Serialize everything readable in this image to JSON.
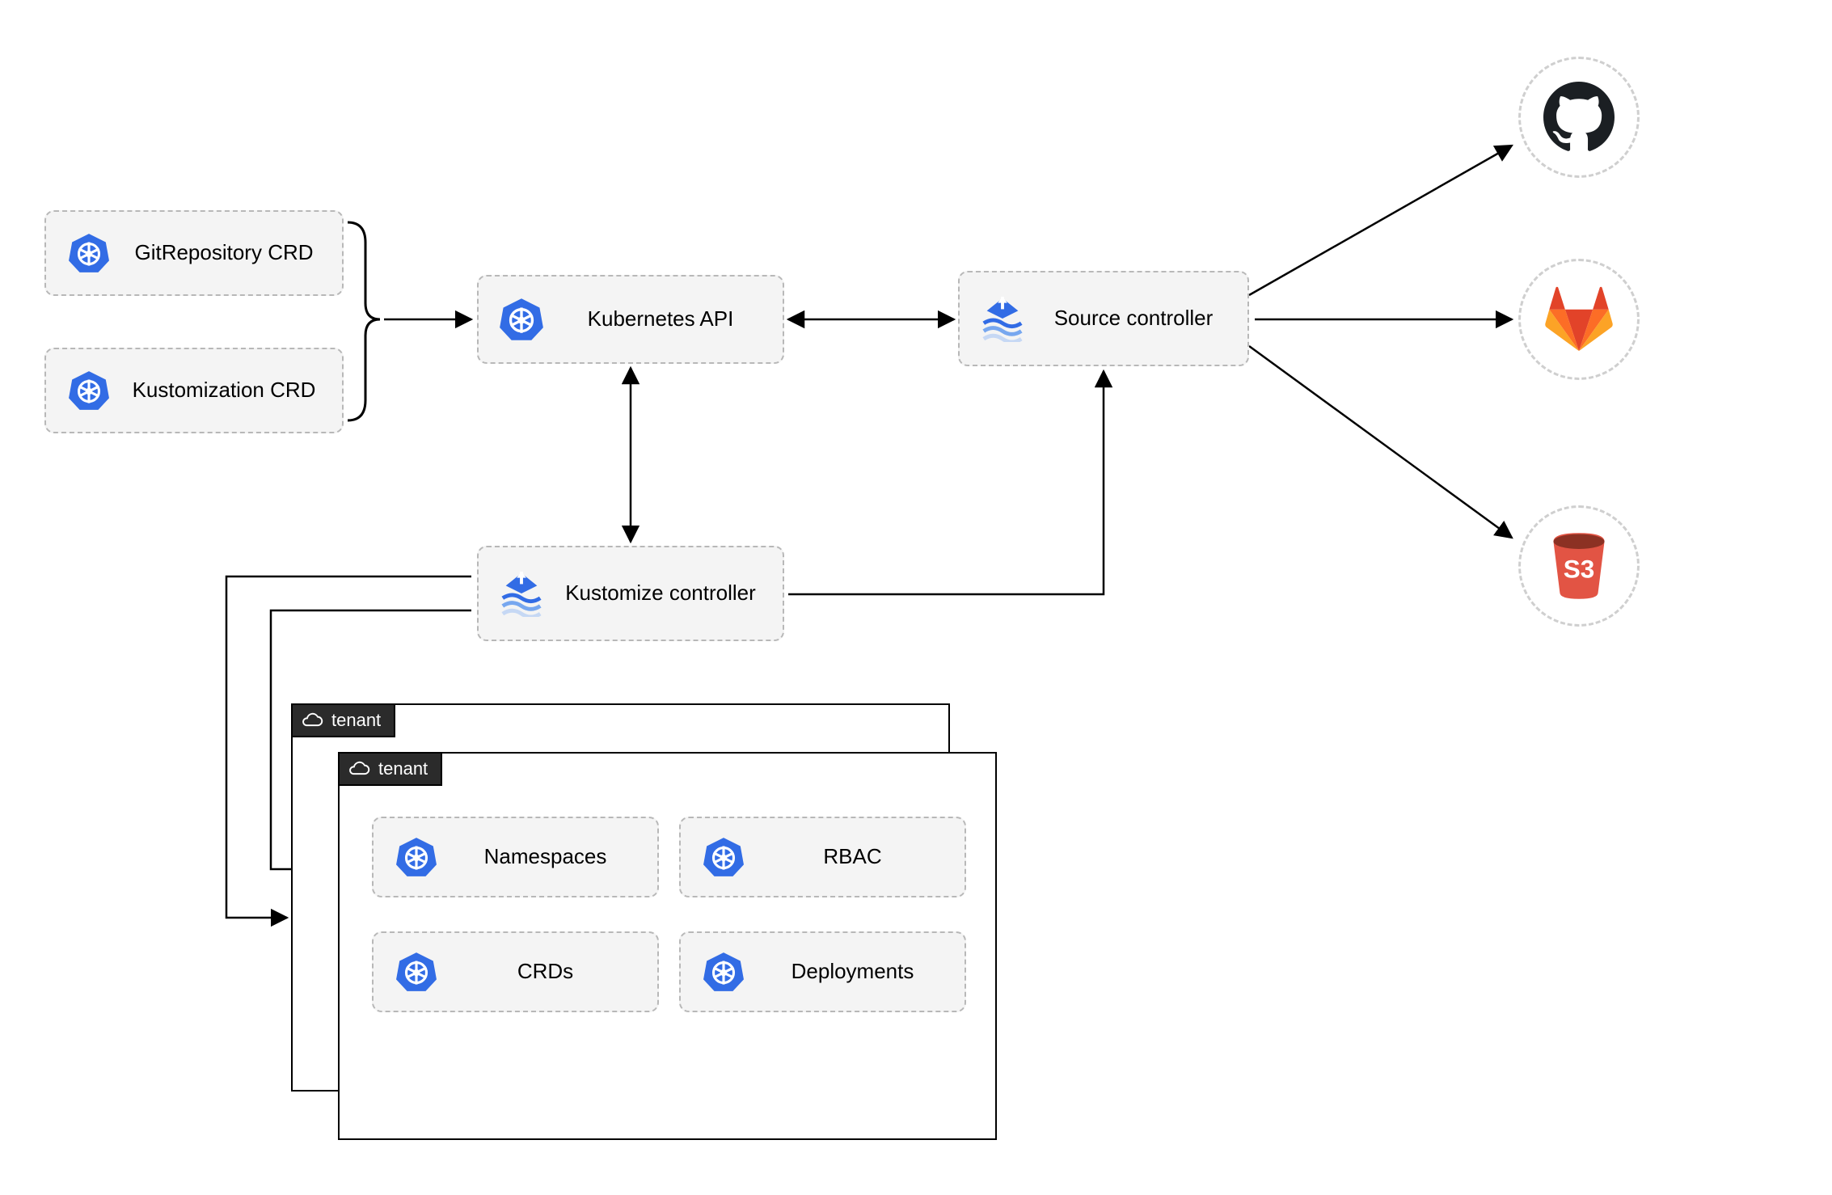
{
  "nodes": {
    "crd_git": "GitRepository CRD",
    "crd_kustomization": "Kustomization CRD",
    "k8s_api": "Kubernetes API",
    "source_controller": "Source controller",
    "kustomize_controller": "Kustomize controller",
    "tenant_back": "tenant",
    "tenant_front": "tenant",
    "namespaces": "Namespaces",
    "rbac": "RBAC",
    "crds": "CRDs",
    "deployments": "Deployments"
  },
  "external": {
    "github": "GitHub",
    "gitlab": "GitLab",
    "s3": "S3"
  },
  "icons": {
    "k8s": "kubernetes-wheel-icon",
    "flux": "flux-controller-icon",
    "cloud": "cloud-icon",
    "github": "github-icon",
    "gitlab": "gitlab-icon",
    "s3": "s3-bucket-icon"
  },
  "colors": {
    "box_bg": "#f4f4f4",
    "box_border": "#b8b8b8",
    "k8s_blue": "#326ce5",
    "gitlab_orange": "#fc6d26",
    "gitlab_red": "#e24329",
    "s3_red": "#e25444",
    "github_dark": "#1b1f23"
  }
}
